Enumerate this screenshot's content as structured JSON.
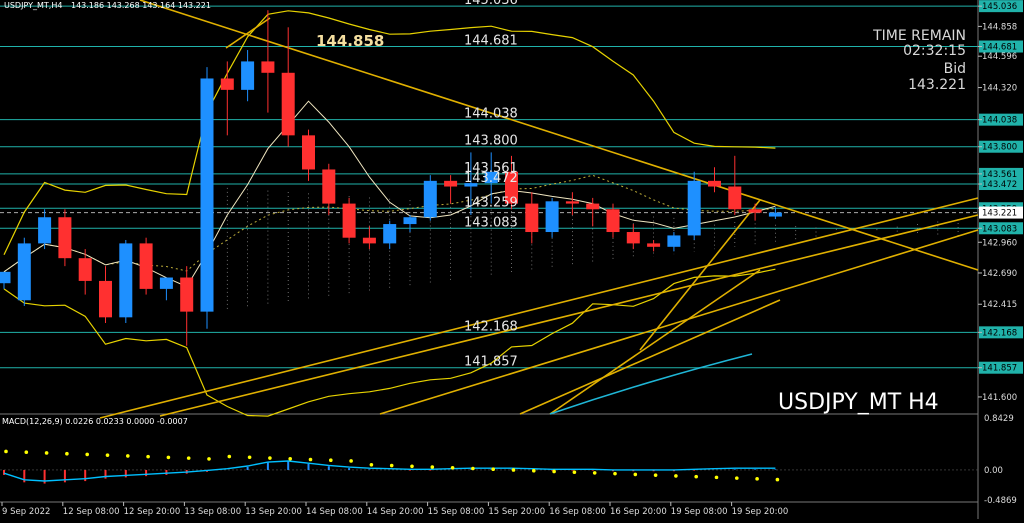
{
  "header": {
    "symbol_info": "USDJPY_MT,H4",
    "ohlc": "143.186 143.268 143.164 143.221"
  },
  "watermark": "USDJPY_MT H4",
  "highlight_price": "144.858",
  "time_remain": {
    "label": "TIME REMAIN",
    "value": "02:32:15"
  },
  "bid": {
    "label": "Bid",
    "value": "143.221"
  },
  "macd": {
    "label": "MACD(12,26,9) 0.0226 0.0233 0.0000 -0.0007",
    "axis": [
      "0.8429",
      "0.00",
      "-0.4869"
    ],
    "range": [
      -0.4869,
      0.8429
    ]
  },
  "x_labels": [
    "9 Sep 2022",
    "12 Sep 08:00",
    "12 Sep 20:00",
    "13 Sep 08:00",
    "13 Sep 20:00",
    "14 Sep 08:00",
    "14 Sep 20:00",
    "15 Sep 08:00",
    "15 Sep 20:00",
    "16 Sep 08:00",
    "16 Sep 20:00",
    "19 Sep 08:00",
    "19 Sep 20:00"
  ],
  "colors": {
    "bull": "#1e90ff",
    "bear": "#ff3030",
    "hline": "#20b2aa",
    "yellow": "#e6d200",
    "gold": "#e0b000",
    "white": "#ffffff",
    "cyan": "#00bfff"
  },
  "chart_data": {
    "type": "candlestick",
    "ylim": [
      141.45,
      145.09
    ],
    "y_ticks": [
      "145.036",
      "144.858",
      "144.681",
      "144.596",
      "144.320",
      "144.038",
      "143.800",
      "143.561",
      "143.472",
      "143.259",
      "143.083",
      "142.960",
      "142.690",
      "142.415",
      "142.168",
      "141.857",
      "141.600"
    ],
    "levels": [
      {
        "price": 145.036,
        "label": "145.036"
      },
      {
        "price": 144.681,
        "label": "144.681"
      },
      {
        "price": 144.038,
        "label": "144.038"
      },
      {
        "price": 143.8,
        "label": "143.800"
      },
      {
        "price": 143.561,
        "label": "143.561"
      },
      {
        "price": 143.472,
        "label": "143.472"
      },
      {
        "price": 143.259,
        "label": "143.259"
      },
      {
        "price": 143.083,
        "label": "143.083"
      },
      {
        "price": 142.168,
        "label": "142.168"
      },
      {
        "price": 141.857,
        "label": "141.857"
      }
    ],
    "candles": [
      {
        "o": 142.6,
        "h": 142.7,
        "c": 142.7,
        "l": 142.55
      },
      {
        "o": 142.45,
        "h": 143.0,
        "c": 142.95,
        "l": 142.4
      },
      {
        "o": 142.95,
        "h": 143.25,
        "c": 143.18,
        "l": 142.9
      },
      {
        "o": 143.18,
        "h": 143.25,
        "c": 142.82,
        "l": 142.75
      },
      {
        "o": 142.82,
        "h": 142.9,
        "c": 142.62,
        "l": 142.5
      },
      {
        "o": 142.62,
        "h": 142.75,
        "c": 142.3,
        "l": 142.25
      },
      {
        "o": 142.3,
        "h": 142.98,
        "c": 142.95,
        "l": 142.25
      },
      {
        "o": 142.95,
        "h": 143.0,
        "c": 142.55,
        "l": 142.5
      },
      {
        "o": 142.55,
        "h": 142.65,
        "c": 142.65,
        "l": 142.45
      },
      {
        "o": 142.65,
        "h": 142.75,
        "c": 142.35,
        "l": 142.05
      },
      {
        "o": 142.35,
        "h": 144.5,
        "c": 144.4,
        "l": 142.2
      },
      {
        "o": 144.4,
        "h": 144.55,
        "c": 144.3,
        "l": 143.9
      },
      {
        "o": 144.3,
        "h": 144.65,
        "c": 144.55,
        "l": 144.2
      },
      {
        "o": 144.55,
        "h": 145.0,
        "c": 144.45,
        "l": 144.1
      },
      {
        "o": 144.45,
        "h": 144.85,
        "c": 143.9,
        "l": 143.8
      },
      {
        "o": 143.9,
        "h": 143.95,
        "c": 143.6,
        "l": 143.5
      },
      {
        "o": 143.6,
        "h": 143.65,
        "c": 143.3,
        "l": 143.2
      },
      {
        "o": 143.3,
        "h": 143.35,
        "c": 143.0,
        "l": 142.95
      },
      {
        "o": 143.0,
        "h": 143.1,
        "c": 142.95,
        "l": 142.9
      },
      {
        "o": 142.95,
        "h": 143.15,
        "c": 143.12,
        "l": 142.9
      },
      {
        "o": 143.12,
        "h": 143.2,
        "c": 143.18,
        "l": 143.05
      },
      {
        "o": 143.18,
        "h": 143.55,
        "c": 143.5,
        "l": 143.15
      },
      {
        "o": 143.5,
        "h": 143.55,
        "c": 143.45,
        "l": 143.3
      },
      {
        "o": 143.45,
        "h": 143.75,
        "c": 143.48,
        "l": 143.2
      },
      {
        "o": 143.48,
        "h": 143.75,
        "c": 143.58,
        "l": 143.3
      },
      {
        "o": 143.58,
        "h": 143.72,
        "c": 143.3,
        "l": 143.25
      },
      {
        "o": 143.3,
        "h": 143.4,
        "c": 143.05,
        "l": 142.95
      },
      {
        "o": 143.05,
        "h": 143.35,
        "c": 143.32,
        "l": 143.0
      },
      {
        "o": 143.32,
        "h": 143.4,
        "c": 143.3,
        "l": 143.2
      },
      {
        "o": 143.3,
        "h": 143.35,
        "c": 143.25,
        "l": 143.1
      },
      {
        "o": 143.25,
        "h": 143.3,
        "c": 143.05,
        "l": 143.0
      },
      {
        "o": 143.05,
        "h": 143.12,
        "c": 142.95,
        "l": 142.9
      },
      {
        "o": 142.95,
        "h": 142.98,
        "c": 142.92,
        "l": 142.88
      },
      {
        "o": 142.92,
        "h": 143.05,
        "c": 143.02,
        "l": 142.88
      },
      {
        "o": 143.02,
        "h": 143.58,
        "c": 143.5,
        "l": 142.98
      },
      {
        "o": 143.5,
        "h": 143.62,
        "c": 143.45,
        "l": 143.4
      },
      {
        "o": 143.45,
        "h": 143.72,
        "c": 143.25,
        "l": 143.2
      },
      {
        "o": 143.25,
        "h": 143.3,
        "c": 143.22,
        "l": 143.15
      },
      {
        "o": 143.186,
        "h": 143.268,
        "c": 143.221,
        "l": 143.164
      }
    ],
    "macd_hist": [
      -0.08,
      -0.2,
      -0.22,
      -0.2,
      -0.18,
      -0.14,
      -0.12,
      -0.1,
      -0.08,
      -0.06,
      -0.03,
      0.0,
      0.05,
      0.12,
      0.14,
      0.1,
      0.06,
      0.03,
      0.01,
      0.0,
      -0.01,
      -0.01,
      0.0,
      0.01,
      0.01,
      0.01,
      0.0,
      -0.01,
      -0.01,
      -0.01,
      -0.02,
      -0.02,
      -0.02,
      -0.02,
      -0.01,
      0.0,
      0.01,
      0.01,
      0.01
    ]
  }
}
